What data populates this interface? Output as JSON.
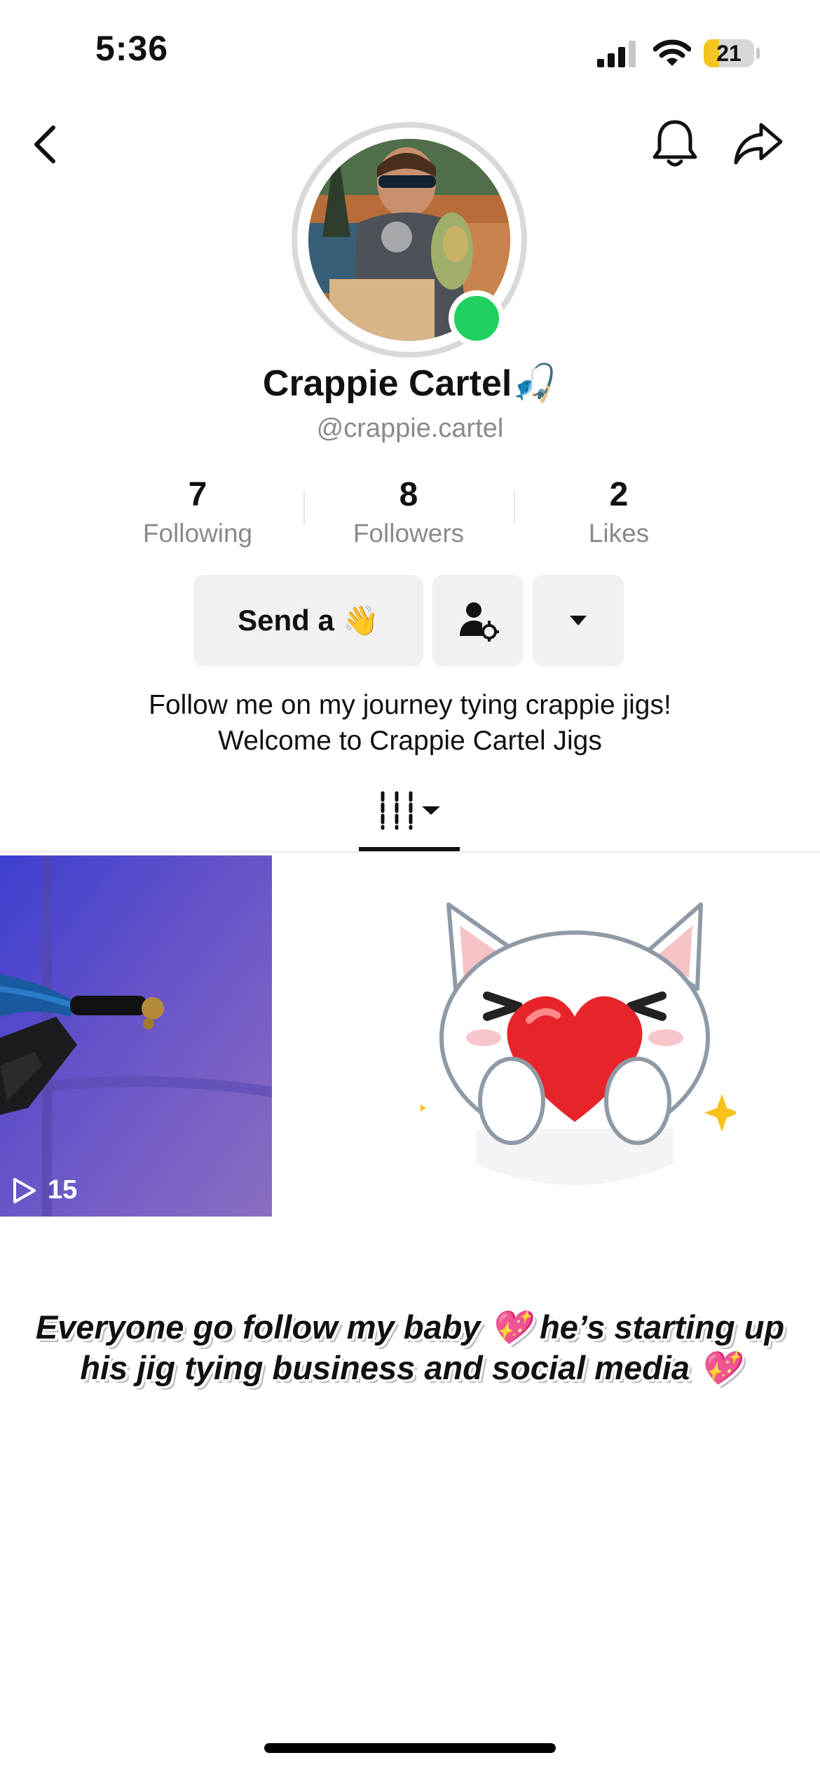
{
  "status_bar": {
    "time": "5:36",
    "battery_level": "21"
  },
  "header": {
    "back_icon": "chevron-left-icon",
    "bell_icon": "bell-icon",
    "share_icon": "share-icon"
  },
  "profile": {
    "display_name": "Crappie Cartel🎣",
    "handle": "@crappie.cartel",
    "online": true,
    "online_color": "#20d161"
  },
  "stats": [
    {
      "value": "7",
      "label": "Following"
    },
    {
      "value": "8",
      "label": "Followers"
    },
    {
      "value": "2",
      "label": "Likes"
    }
  ],
  "actions": {
    "send_label": "Send a 👋",
    "friend_settings_icon": "person-gear-icon",
    "more_icon": "caret-down-icon"
  },
  "bio": {
    "line1": "Follow me on my journey tying crappie jigs!",
    "line2": "Welcome to Crappie Cartel Jigs"
  },
  "tabs": {
    "active_icon": "grid-icon"
  },
  "videos": [
    {
      "views": "15",
      "play_icon": "play-outline-icon"
    }
  ],
  "sticker": {
    "name": "cat-holding-heart-sticker"
  },
  "overlay_caption": {
    "line1": "Everyone go follow my baby 💖 he’s starting up",
    "line2": "his jig tying business and social media 💖"
  }
}
